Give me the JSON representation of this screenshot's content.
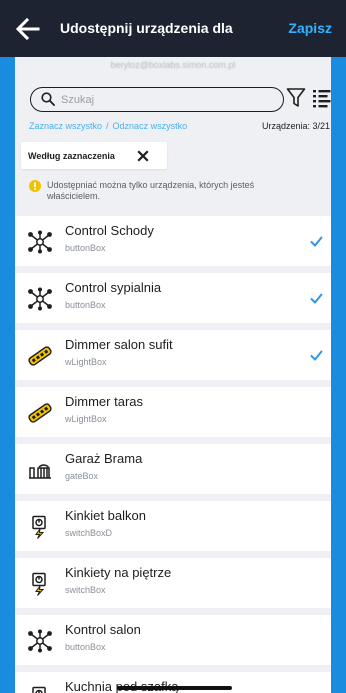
{
  "header": {
    "title": "Udostępnij urządzenia dla",
    "save_label": "Zapisz",
    "account_email": "beryloz@boxlabs.simon.com.pl"
  },
  "search": {
    "placeholder": "Szukaj",
    "value": ""
  },
  "selection": {
    "select_all": "Zaznacz wszystko",
    "separator": "/",
    "deselect_all": "Odznacz wszystko",
    "device_count": "Urządzenia: 3/21"
  },
  "sort_chip": {
    "label": "Według zaznaczenia"
  },
  "info": {
    "text": "Udostępniać można tylko urządzenia, których jesteś właścicielem."
  },
  "colors": {
    "accent": "#1a8cdf",
    "header_bg": "#1d2330",
    "save": "#32b2ff",
    "check": "#2f97e6",
    "info_icon": "#f2c200"
  },
  "devices": [
    {
      "name": "Control Schody",
      "type": "buttonBox",
      "icon": "button-box-icon",
      "checked": true
    },
    {
      "name": "Control sypialnia",
      "type": "buttonBox",
      "icon": "button-box-icon",
      "checked": true
    },
    {
      "name": "Dimmer salon sufit",
      "type": "wLightBox",
      "icon": "led-strip-icon",
      "checked": true
    },
    {
      "name": "Dimmer taras",
      "type": "wLightBox",
      "icon": "led-strip-icon",
      "checked": false
    },
    {
      "name": "Garaż Brama",
      "type": "gateBox",
      "icon": "gate-icon",
      "checked": false
    },
    {
      "name": "Kinkiet balkon",
      "type": "switchBoxD",
      "icon": "switch-box-icon",
      "checked": false
    },
    {
      "name": "Kinkiety na piętrze",
      "type": "switchBox",
      "icon": "switch-box-icon",
      "checked": false
    },
    {
      "name": "Kontrol salon",
      "type": "buttonBox",
      "icon": "button-box-icon",
      "checked": false
    },
    {
      "name": "Kuchnia pod szafką",
      "type": "",
      "icon": "switch-box-icon",
      "checked": false
    }
  ]
}
